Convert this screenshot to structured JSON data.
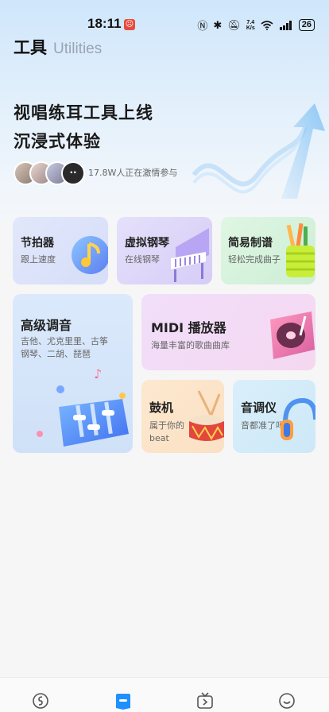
{
  "status_bar": {
    "time": "18:11",
    "alert_glyph": "☹",
    "net_speed_top": "7.4",
    "net_speed_bottom": "K/s",
    "battery": "26"
  },
  "header": {
    "title": "工具",
    "subtitle": "Utilities"
  },
  "banner": {
    "line1": "视唱练耳工具上线",
    "line2": "沉浸式体验",
    "participants": "17.8W人正在激情参与",
    "more_glyph": "··"
  },
  "tools": {
    "metronome": {
      "title": "节拍器",
      "desc": "跟上速度"
    },
    "piano": {
      "title": "虚拟钢琴",
      "desc": "在线钢琴"
    },
    "score": {
      "title": "简易制谱",
      "desc": "轻松完成曲子"
    },
    "advanced": {
      "title": "高级调音",
      "desc_line1": "吉他、尤克里里、古筝",
      "desc_line2": "钢琴、二胡、琵琶"
    },
    "midi": {
      "title": "MIDI 播放器",
      "desc": "海量丰富的歌曲曲库"
    },
    "drum": {
      "title": "鼓机",
      "desc_line1": "属于你的",
      "desc_line2": "beat"
    },
    "tuner": {
      "title": "音调仪",
      "desc": "音都准了吗"
    }
  },
  "tabbar": {
    "icons": [
      "discover-icon",
      "tools-icon",
      "video-icon",
      "profile-icon"
    ],
    "active_color": "#1e90ff"
  }
}
